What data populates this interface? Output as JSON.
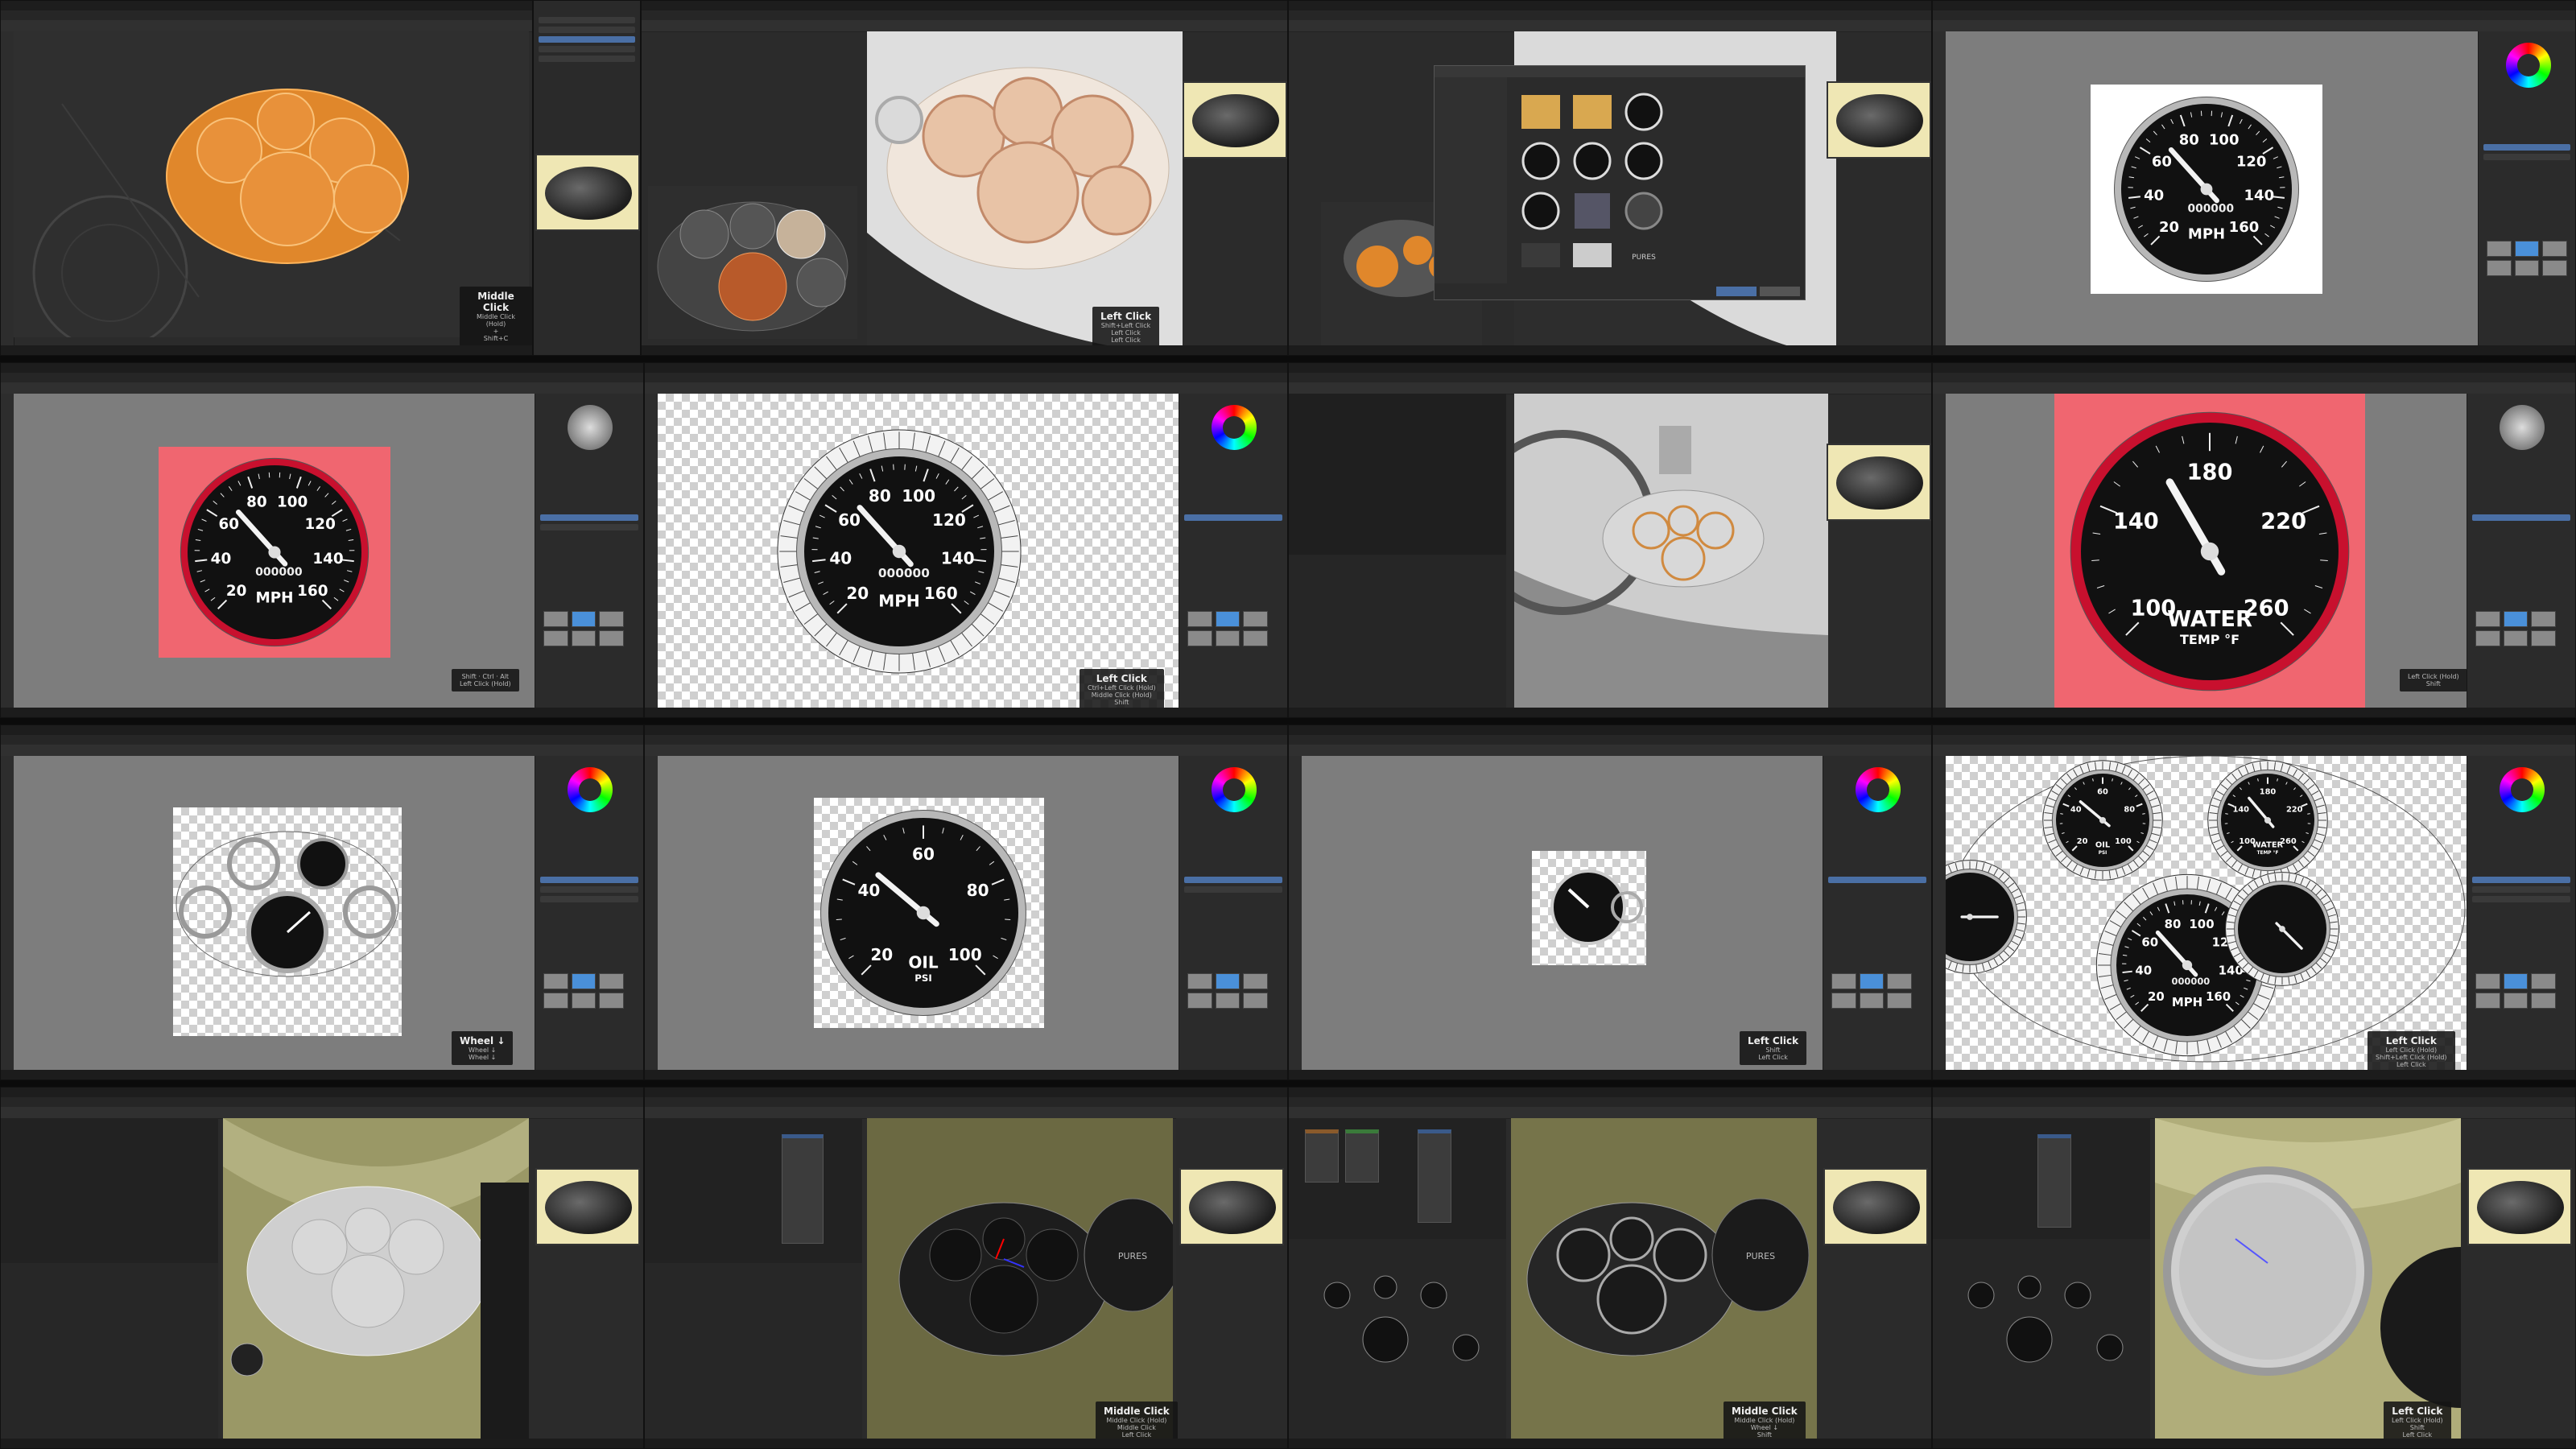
{
  "sheet": {
    "columns": 4,
    "rows": 4
  },
  "tiles": [
    {
      "id": "r1c1",
      "app": "blender",
      "hint": {
        "title": "Middle Click",
        "lines": [
          "Middle Click (Hold)",
          "+",
          "Shift+C"
        ]
      }
    },
    {
      "id": "r1c2",
      "app": "blender",
      "hint": {
        "title": "Left Click",
        "lines": [
          "Shift+Left Click",
          "Left Click",
          "Left Click"
        ]
      }
    },
    {
      "id": "r1c3",
      "app": "blender",
      "file_browser": {
        "bottom_label": "PURES"
      }
    },
    {
      "id": "r1c4",
      "app": "gimp",
      "gauge": {
        "unit": "MPH",
        "ticks": [
          "20",
          "40",
          "60",
          "80",
          "100",
          "120",
          "140",
          "160"
        ],
        "odometer": "000000"
      }
    },
    {
      "id": "r2c1",
      "app": "gimp",
      "gauge": {
        "unit": "MPH",
        "ticks": [
          "20",
          "40",
          "60",
          "80",
          "100",
          "120",
          "140",
          "160"
        ],
        "odometer": "000000"
      }
    },
    {
      "id": "r2c2",
      "app": "gimp",
      "gauge": {
        "unit": "MPH",
        "ticks": [
          "20",
          "40",
          "60",
          "80",
          "100",
          "120",
          "140",
          "160"
        ],
        "odometer": "000000"
      },
      "hint": {
        "title": "Left Click",
        "lines": [
          "Ctrl+Left Click (Hold)",
          "Middle Click (Hold)",
          "Shift"
        ]
      }
    },
    {
      "id": "r2c3",
      "app": "blender"
    },
    {
      "id": "r2c4",
      "app": "gimp",
      "gauge": {
        "unit": "WATER",
        "sub": "TEMP °F",
        "ticks": [
          "100",
          "140",
          "180",
          "220",
          "260"
        ]
      }
    },
    {
      "id": "r3c1",
      "app": "gimp",
      "hint": {
        "title": "Wheel ↓",
        "lines": [
          "Wheel ↓",
          "Wheel ↓",
          "Wheel ↓"
        ]
      }
    },
    {
      "id": "r3c2",
      "app": "gimp",
      "gauge": {
        "unit": "OIL",
        "sub": "PSI",
        "ticks": [
          "20",
          "40",
          "60",
          "80",
          "100"
        ]
      }
    },
    {
      "id": "r3c3",
      "app": "gimp",
      "hint": {
        "title": "Left Click",
        "lines": [
          "Shift",
          "Left Click"
        ]
      }
    },
    {
      "id": "r3c4",
      "app": "gimp",
      "gauges": {
        "mph": {
          "unit": "MPH",
          "ticks": [
            "20",
            "40",
            "60",
            "80",
            "100",
            "120",
            "140",
            "160"
          ],
          "odometer": "000000"
        },
        "water": {
          "unit": "WATER",
          "sub": "TEMP °F",
          "ticks": [
            "100",
            "140",
            "180",
            "220",
            "260"
          ]
        },
        "oil": {
          "unit": "OIL",
          "sub": "PSI",
          "ticks": [
            "20",
            "40",
            "60",
            "80",
            "100"
          ]
        }
      },
      "hint": {
        "title": "Left Click",
        "lines": [
          "Left Click (Hold)",
          "Shift+Left Click (Hold)",
          "Left Click"
        ]
      }
    },
    {
      "id": "r4c1",
      "app": "blender"
    },
    {
      "id": "r4c2",
      "app": "blender",
      "hint": {
        "title": "Middle Click",
        "lines": [
          "Middle Click (Hold)",
          "Middle Click",
          "Left Click"
        ]
      },
      "dash_label": "PURES"
    },
    {
      "id": "r4c3",
      "app": "blender",
      "hint": {
        "title": "Middle Click",
        "lines": [
          "Middle Click (Hold)",
          "Wheel ↓",
          "Shift"
        ]
      },
      "dash_label": "PURES"
    },
    {
      "id": "r4c4",
      "app": "blender",
      "hint": {
        "title": "Left Click",
        "lines": [
          "Left Click (Hold)",
          "Shift",
          "Left Click"
        ]
      }
    }
  ],
  "colors": {
    "gimp_canvas": "#7d7d7d",
    "blender_bg": "#2b2b2b",
    "selection_orange": "#e58a2b",
    "red_bg": "#f06670",
    "cream": "#efe7b4",
    "olive": "#8c8a5c"
  }
}
